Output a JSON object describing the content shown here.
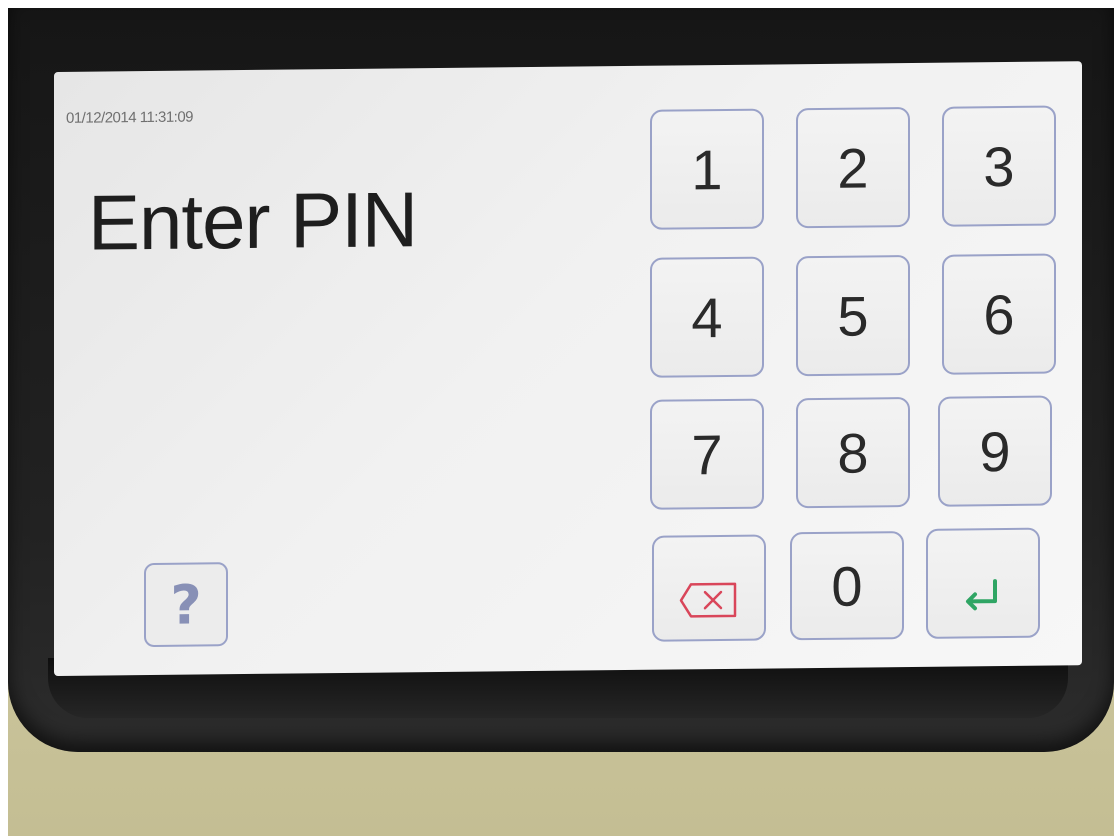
{
  "screen": {
    "timestamp": "01/12/2014 11:31:09",
    "title": "Enter PIN"
  },
  "keypad": {
    "keys": [
      "1",
      "2",
      "3",
      "4",
      "5",
      "6",
      "7",
      "8",
      "9",
      "0"
    ],
    "backspace_icon": "backspace-icon",
    "enter_icon": "enter-icon"
  },
  "help": {
    "label": "?"
  },
  "colors": {
    "key_border": "#9aa2c8",
    "backspace": "#d9465a",
    "enter": "#2fa564",
    "help": "#8890b6"
  }
}
